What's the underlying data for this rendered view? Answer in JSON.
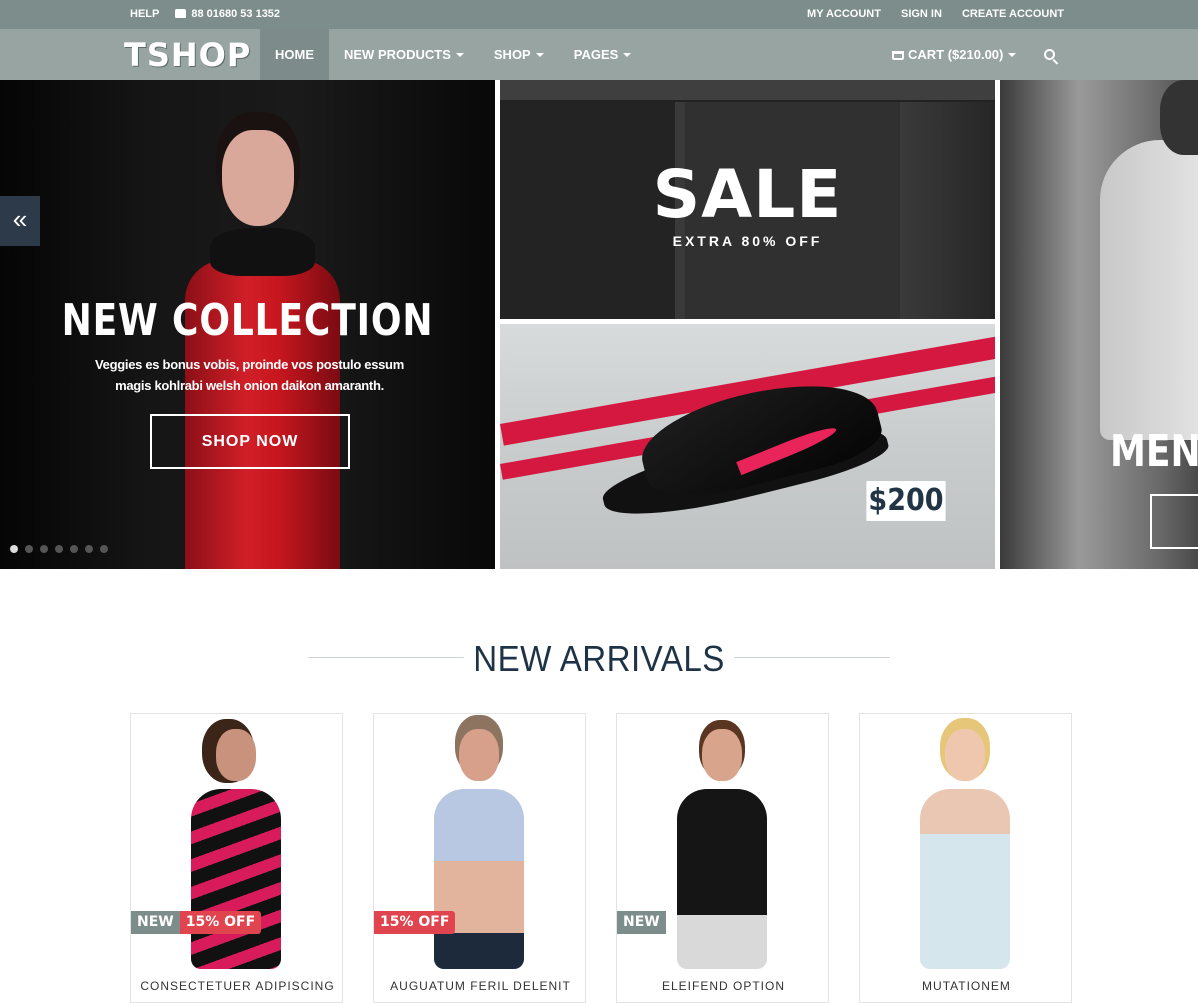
{
  "topbar": {
    "help": "HELP",
    "phone": "88 01680 53 1352",
    "my_account": "MY ACCOUNT",
    "sign_in": "SIGN IN",
    "create_account": "CREATE ACCOUNT"
  },
  "navbar": {
    "logo": "TSHOP",
    "items": [
      {
        "label": "HOME"
      },
      {
        "label": "NEW PRODUCTS"
      },
      {
        "label": "SHOP"
      },
      {
        "label": "PAGES"
      }
    ],
    "cart": "CART ($210.00)"
  },
  "hero": {
    "main": {
      "title": "NEW COLLECTION",
      "text": "Veggies es bonus vobis, proinde vos postulo essum magis kohlrabi welsh onion daikon amaranth.",
      "button": "SHOP NOW"
    },
    "prev_arrow": "«",
    "sale": {
      "title": "SALE",
      "subtitle": "EXTRA 80% OFF"
    },
    "shoe": {
      "price": "$200"
    },
    "men": {
      "title": "MEN C"
    },
    "dots_total": 7,
    "dots_active": 1
  },
  "new_arrivals": {
    "title": "NEW ARRIVALS",
    "products": [
      {
        "badges": [
          {
            "type": "new",
            "text": "NEW"
          },
          {
            "type": "off",
            "text": "15% OFF"
          }
        ],
        "name": "CONSECTETUER ADIPISCING"
      },
      {
        "badges": [
          {
            "type": "off",
            "text": "15% OFF"
          }
        ],
        "name": "AUGUATUM FERIL DELENIT"
      },
      {
        "badges": [
          {
            "type": "new",
            "text": "NEW"
          }
        ],
        "name": "ELEIFEND OPTION"
      },
      {
        "badges": [],
        "name": "MUTATIONEM"
      }
    ]
  },
  "colors": {
    "topbar": "#7c8d8b",
    "navbar": "#97a4a2",
    "accent_red": "#e0444e",
    "heading": "#1f3347"
  }
}
